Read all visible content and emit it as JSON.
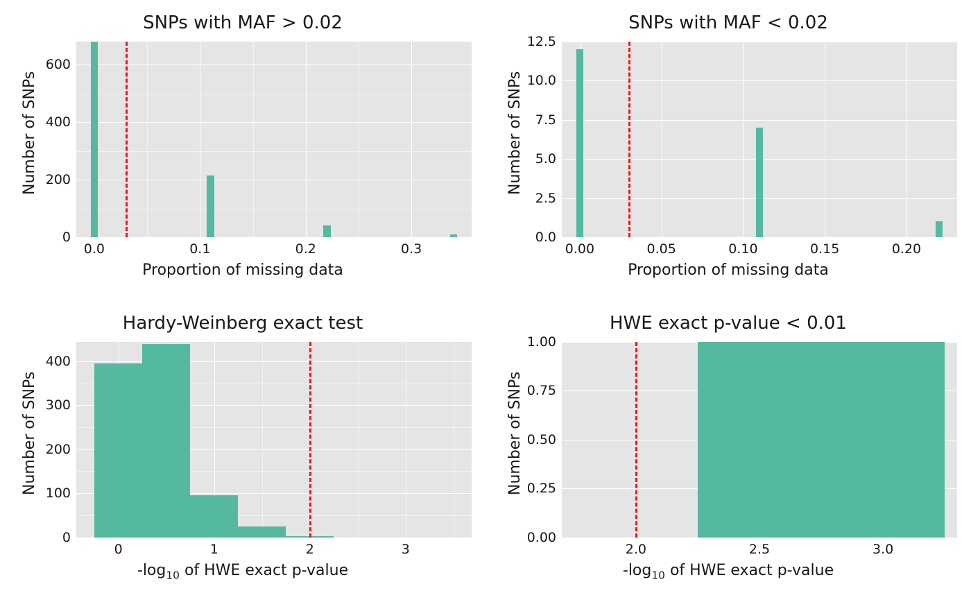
{
  "colors": {
    "bar": "#55b9a0",
    "vline": "#e41a1c",
    "plot_bg": "#e5e5e5"
  },
  "chart_data": [
    {
      "id": "p1",
      "type": "bar",
      "title": "SNPs with MAF >  0.02",
      "xlabel": "Proportion of missing data",
      "ylabel": "Number of SNPs",
      "xlim": [
        -0.017,
        0.357
      ],
      "ylim": [
        0,
        680
      ],
      "xticks": [
        0.0,
        0.1,
        0.2,
        0.3
      ],
      "yticks": [
        0,
        200,
        400,
        600
      ],
      "yminor": [
        100,
        300,
        500
      ],
      "xminor": [
        0.05,
        0.15,
        0.25
      ],
      "bar_w": 0.007,
      "bars": [
        {
          "x": 0.0,
          "y": 680
        },
        {
          "x": 0.11,
          "y": 215
        },
        {
          "x": 0.22,
          "y": 40
        },
        {
          "x": 0.34,
          "y": 10
        }
      ],
      "vline": 0.03
    },
    {
      "id": "p2",
      "type": "bar",
      "title": "SNPs with MAF <  0.02",
      "xlabel": "Proportion of missing data",
      "ylabel": "Number of SNPs",
      "xlim": [
        -0.011,
        0.231
      ],
      "ylim": [
        0,
        12.5
      ],
      "xticks": [
        0.0,
        0.05,
        0.1,
        0.15,
        0.2
      ],
      "yticks": [
        0.0,
        2.5,
        5.0,
        7.5,
        10.0,
        12.5
      ],
      "yminor": [],
      "xminor": [],
      "bar_w": 0.0045,
      "bars": [
        {
          "x": 0.0,
          "y": 12
        },
        {
          "x": 0.11,
          "y": 7
        },
        {
          "x": 0.22,
          "y": 1
        }
      ],
      "vline": 0.03
    },
    {
      "id": "p3",
      "type": "bar",
      "title": "Hardy-Weinberg exact test",
      "xlabel": "-log<sub>10</sub> of HWE exact p-value",
      "ylabel": "Number of SNPs",
      "xlim": [
        -0.44,
        3.69
      ],
      "ylim": [
        0,
        445
      ],
      "xticks": [
        0,
        1,
        2,
        3
      ],
      "yticks": [
        0,
        100,
        200,
        300,
        400
      ],
      "yminor": [
        50,
        150,
        250,
        350
      ],
      "xminor": [
        0.5,
        1.5,
        2.5,
        3.5
      ],
      "bar_w": 0.5,
      "bars": [
        {
          "x": 0.0,
          "y": 395
        },
        {
          "x": 0.5,
          "y": 440
        },
        {
          "x": 1.0,
          "y": 95
        },
        {
          "x": 1.5,
          "y": 25
        },
        {
          "x": 2.0,
          "y": 3
        }
      ],
      "edge": "-0.25",
      "vline": 2.0
    },
    {
      "id": "p4",
      "type": "bar",
      "title": "HWE exact p-value < 0.01",
      "xlabel": "-log<sub>10</sub> of HWE exact p-value",
      "ylabel": "Number of SNPs",
      "xlim": [
        1.7,
        3.3
      ],
      "ylim": [
        0,
        1.0
      ],
      "xticks": [
        2.0,
        2.5,
        3.0
      ],
      "yticks": [
        0.0,
        0.25,
        0.5,
        0.75,
        1.0
      ],
      "yminor": [],
      "xminor": [],
      "bar_w": 1.0,
      "bars": [
        {
          "x": 2.75,
          "y": 1.0
        }
      ],
      "edge": "2.25",
      "vline": 2.0
    }
  ],
  "xtick_labels": {
    "p1": [
      "0.0",
      "0.1",
      "0.2",
      "0.3"
    ],
    "p2": [
      "0.00",
      "0.05",
      "0.10",
      "0.15",
      "0.20"
    ],
    "p3": [
      "0",
      "1",
      "2",
      "3"
    ],
    "p4": [
      "2.0",
      "2.5",
      "3.0"
    ]
  },
  "ytick_labels": {
    "p1": [
      "0",
      "200",
      "400",
      "600"
    ],
    "p2": [
      "0.0",
      "2.5",
      "5.0",
      "7.5",
      "10.0",
      "12.5"
    ],
    "p3": [
      "0",
      "100",
      "200",
      "300",
      "400"
    ],
    "p4": [
      "0.00",
      "0.25",
      "0.50",
      "0.75",
      "1.00"
    ]
  }
}
